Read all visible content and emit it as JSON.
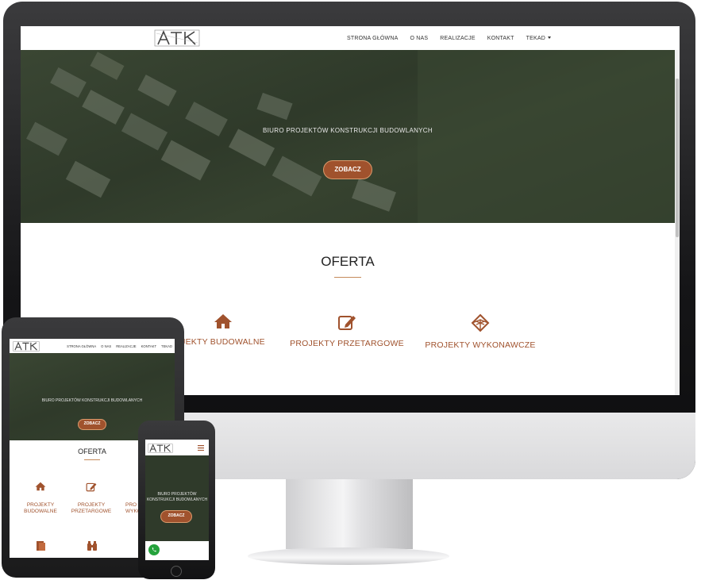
{
  "site": {
    "logo_text": "ATK",
    "nav": [
      "STRONA GŁÓWNA",
      "O NAS",
      "REALIZACJE",
      "KONTAKT",
      "TEKAD"
    ],
    "hero_text": "BIURO PROJEKTÓW KONSTRUKCJI BUDOWLANYCH",
    "hero_button": "ZOBACZ",
    "section_title": "OFERTA",
    "services": [
      {
        "label": "PROJEKTY BUDOWALNE",
        "icon": "home-icon"
      },
      {
        "label": "PROJEKTY PRZETARGOWE",
        "icon": "edit-icon"
      },
      {
        "label": "PROJEKTY WYKONAWCZE",
        "icon": "cube-icon"
      }
    ]
  },
  "desktop_visible": {
    "service_0_label": "JEKTY BUDOWALNE"
  },
  "tablet": {
    "service_0_label": "PROJEKTY BUDOWALNE",
    "service_1_label": "PROJEKTY PRZETARGOWE",
    "service_2_label": "PRO WYKO"
  },
  "colors": {
    "accent": "#a0522d",
    "accent_light": "#d99a6c",
    "hero_overlay": "#2f3a2a",
    "whatsapp": "#25a33c"
  }
}
